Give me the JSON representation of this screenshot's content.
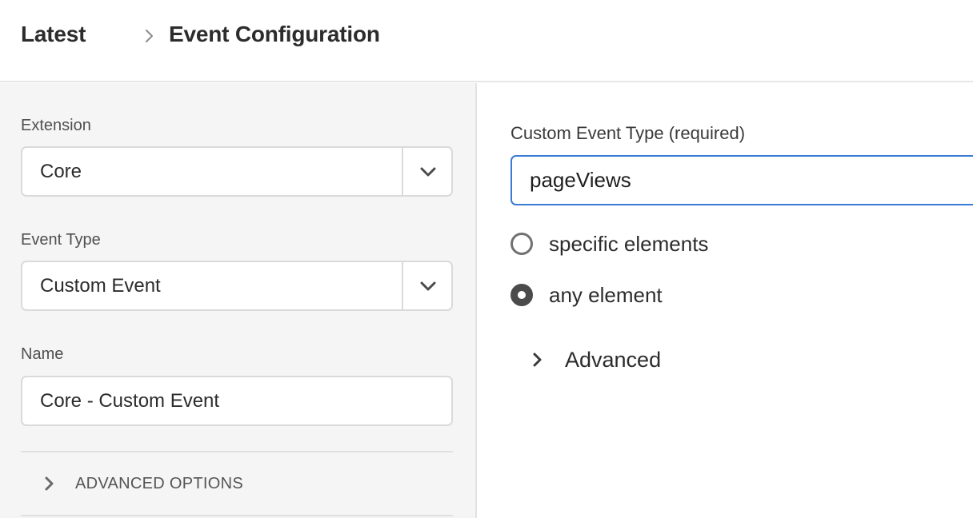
{
  "breadcrumb": {
    "root": "Latest",
    "current": "Event Configuration"
  },
  "left_panel": {
    "extension": {
      "label": "Extension",
      "value": "Core"
    },
    "event_type": {
      "label": "Event Type",
      "value": "Custom Event"
    },
    "name": {
      "label": "Name",
      "value": "Core - Custom Event"
    },
    "advanced_options": "ADVANCED OPTIONS"
  },
  "right_panel": {
    "custom_event_type": {
      "label": "Custom Event Type (required)",
      "value": "pageViews"
    },
    "radios": [
      {
        "label": "specific elements",
        "selected": false
      },
      {
        "label": "any element",
        "selected": true
      }
    ],
    "advanced": "Advanced"
  },
  "icons": {
    "breadcrumb_separator": "chevron-right-icon",
    "dropdown": "chevron-down-icon",
    "disclosure": "chevron-right-icon"
  },
  "colors": {
    "focus_border": "#3a7bd5",
    "panel_bg": "#f5f5f5"
  }
}
